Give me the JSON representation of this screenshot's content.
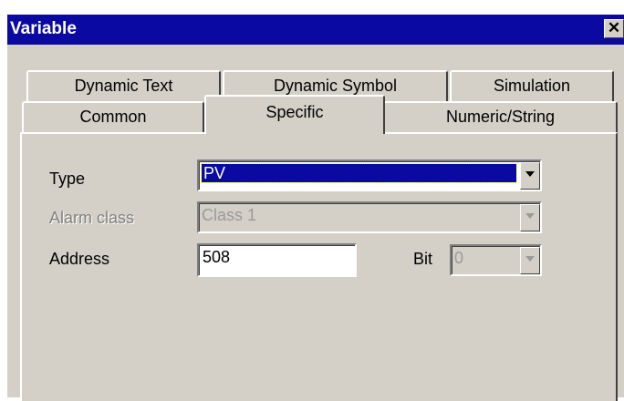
{
  "window": {
    "title": "Variable",
    "close_glyph": "✕"
  },
  "tabs": {
    "row1": [
      "Dynamic Text",
      "Dynamic Symbol",
      "Simulation"
    ],
    "row2": [
      "Common",
      "Specific",
      "Numeric/String"
    ],
    "active": "Specific"
  },
  "form": {
    "type_label": "Type",
    "type_value": "PV",
    "alarm_class_label": "Alarm class",
    "alarm_class_value": "Class 1",
    "address_label": "Address",
    "address_value": "508",
    "bit_label": "Bit",
    "bit_value": "0"
  },
  "colors": {
    "titlebar": "#0a0aa2",
    "face": "#d4d0c8",
    "selection": "#0a0aa2"
  }
}
